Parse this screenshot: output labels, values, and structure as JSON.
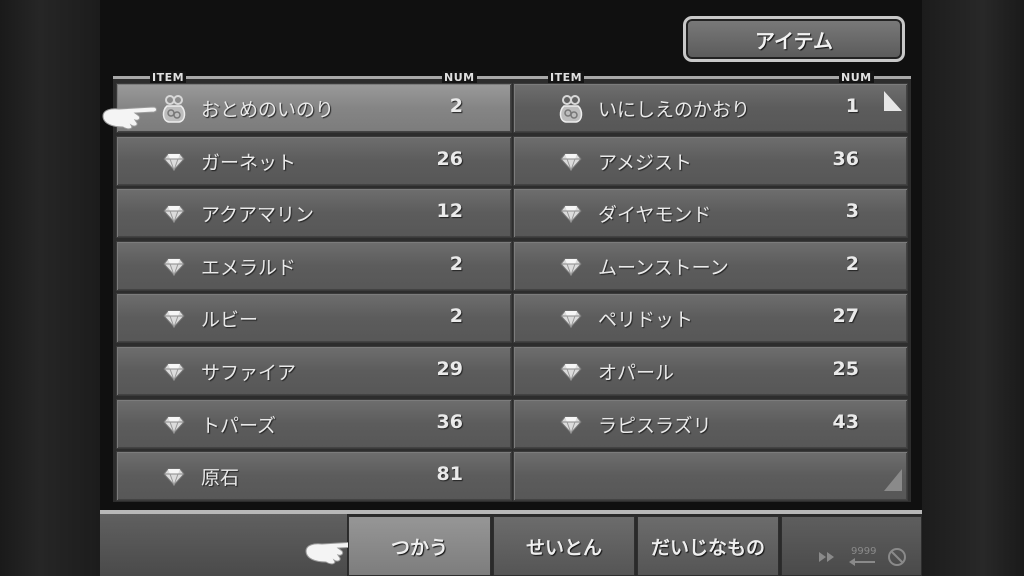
{
  "window_title": "アイテム",
  "headers": {
    "item_left": "ITEM",
    "num_left": "NUM",
    "item_right": "ITEM",
    "num_right": "NUM"
  },
  "left_column": [
    {
      "name": "おとめのいのり",
      "num": "2",
      "icon": "bag-icon",
      "selected": true
    },
    {
      "name": "ガーネット",
      "num": "26",
      "icon": "gem-icon"
    },
    {
      "name": "アクアマリン",
      "num": "12",
      "icon": "gem-icon"
    },
    {
      "name": "エメラルド",
      "num": "2",
      "icon": "gem-icon"
    },
    {
      "name": "ルビー",
      "num": "2",
      "icon": "gem-icon"
    },
    {
      "name": "サファイア",
      "num": "29",
      "icon": "gem-icon"
    },
    {
      "name": "トパーズ",
      "num": "36",
      "icon": "gem-icon"
    },
    {
      "name": "原石",
      "num": "81",
      "icon": "gem-icon"
    }
  ],
  "right_column": [
    {
      "name": "いにしえのかおり",
      "num": "1",
      "icon": "bag-icon"
    },
    {
      "name": "アメジスト",
      "num": "36",
      "icon": "gem-icon"
    },
    {
      "name": "ダイヤモンド",
      "num": "3",
      "icon": "gem-icon"
    },
    {
      "name": "ムーンストーン",
      "num": "2",
      "icon": "gem-icon"
    },
    {
      "name": "ペリドット",
      "num": "27",
      "icon": "gem-icon"
    },
    {
      "name": "オパール",
      "num": "25",
      "icon": "gem-icon"
    },
    {
      "name": "ラピスラズリ",
      "num": "43",
      "icon": "gem-icon"
    },
    {
      "name": "",
      "num": "",
      "icon": ""
    }
  ],
  "commands": {
    "use": "つかう",
    "sort": "せいとん",
    "key_items": "だいじなもの",
    "selected": "use"
  },
  "controls": {
    "fast_forward": "fast-forward-icon",
    "speed": "9999",
    "no_encounter": "no-encounter-icon"
  },
  "colors": {
    "panel_bg": "#5c5c5c",
    "selected_row": "#858585",
    "text": "#eaeaea",
    "border": "#b8b8b8"
  }
}
